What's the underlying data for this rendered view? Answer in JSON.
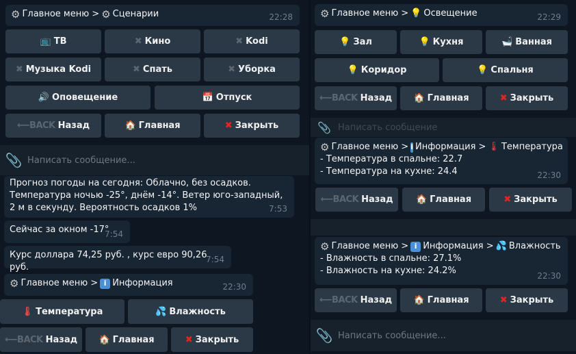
{
  "left": {
    "scenarios_header": {
      "path": "Главное меню > ",
      "title": "Сценарии",
      "time": "22:28"
    },
    "scenario_rows": [
      [
        {
          "icon": "tv-icon",
          "glyph": "📺",
          "label": "ТВ"
        },
        {
          "icon": "x-grey-icon",
          "glyph": "✖",
          "label": "Кино"
        },
        {
          "icon": "x-grey-icon",
          "glyph": "✖",
          "label": "Kodi"
        }
      ],
      [
        {
          "icon": "x-grey-icon",
          "glyph": "✖",
          "label": "Музыка Kodi"
        },
        {
          "icon": "x-grey-icon",
          "glyph": "✖",
          "label": "Спать"
        },
        {
          "icon": "x-grey-icon",
          "glyph": "✖",
          "label": "Уборка"
        }
      ],
      [
        {
          "icon": "speaker-icon",
          "glyph": "🔊",
          "label": "Оповещение"
        },
        {
          "icon": "calendar-icon",
          "glyph": "📅",
          "label": "Отпуск"
        }
      ]
    ],
    "nav1": {
      "back": "Назад",
      "back_badge": "BACK",
      "home": "Главная",
      "close": "Закрыть"
    },
    "input_placeholder": "Написать сообщение...",
    "weather": {
      "text": "Прогноз погоды на сегодня: Облачно, без осадков. Температура ночью -25°, днём -14°. Ветер юго-западный, 2 м в секунду. Вероятность осадков 1%",
      "time": "7:53"
    },
    "outside": {
      "text": "Сейчас за окном -17°",
      "time": "7:54"
    },
    "rate": {
      "text": "Курс доллара 74,25 руб. , курс евро 90,26 руб.",
      "time": "7:54"
    },
    "info_header": {
      "path": "Главное меню > ",
      "title": "Информация",
      "time": "22:30"
    },
    "info_buttons": {
      "temp": "Температура",
      "hum": "Влажность"
    },
    "nav2": {
      "back": "Назад",
      "back_badge": "BACK",
      "home": "Главная",
      "close": "Закрыть"
    }
  },
  "right": {
    "light_header": {
      "path": "Главное меню > ",
      "title": "Освещение",
      "time": "22:29"
    },
    "light_rows": [
      [
        "Зал",
        "Кухня",
        "Ванная"
      ],
      [
        "Коридор",
        "Спальня"
      ]
    ],
    "nav1": {
      "back": "Назад",
      "back_badge": "BACK",
      "home": "Главная",
      "close": "Закрыть"
    },
    "ghost_placeholder": "Написать сообщение",
    "temp_msg": {
      "path": "Главное меню > ",
      "mid": "Информация > ",
      "title": "Температура",
      "line1": "- Температура в спальне: 22.7",
      "line2": "- Температура на кухне: 24.4",
      "time": "22:30"
    },
    "nav2": {
      "back": "Назад",
      "back_badge": "BACK",
      "home": "Главная",
      "close": "Закрыть"
    },
    "hum_msg": {
      "path": "Главное меню > ",
      "mid": "Информация > ",
      "title": "Влажность",
      "line1": "- Влажность в спальне: 27.1%",
      "line2": "- Влажность на кухне: 24.2%",
      "time": "22:30"
    },
    "nav3": {
      "back": "Назад",
      "back_badge": "BACK",
      "home": "Главная",
      "close": "Закрыть"
    },
    "input_placeholder": "Написать сообщение..."
  },
  "colors": {
    "bg": "#0e1621",
    "bubble": "#182533",
    "button": "#2b3947",
    "input": "#17212b",
    "close_x": "#e8231f"
  }
}
